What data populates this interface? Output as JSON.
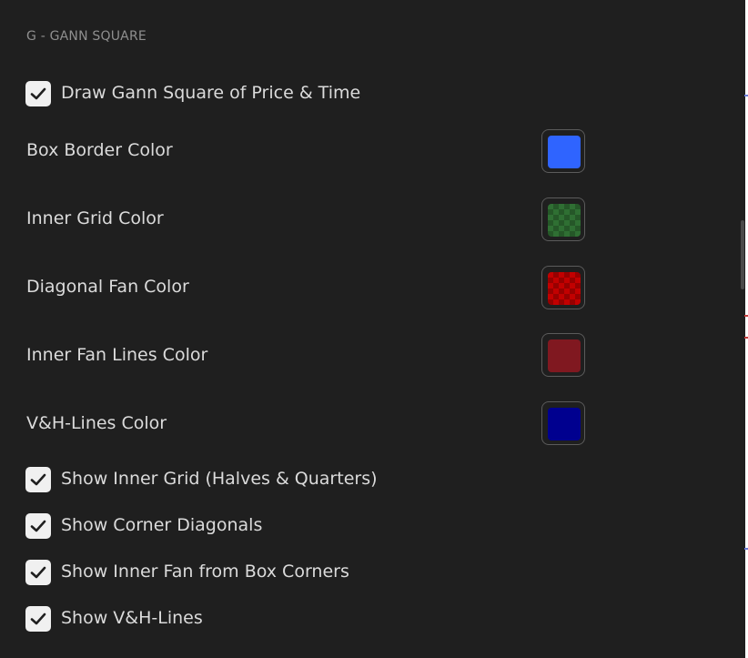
{
  "section": {
    "title": "G - GANN SQUARE"
  },
  "draw_gann_square": {
    "label": "Draw Gann Square of Price & Time",
    "checked": true
  },
  "color_settings": [
    {
      "label": "Box Border Color",
      "color": "#2f64ff",
      "pattern": "solid",
      "icon": "color-swatch-icon"
    },
    {
      "label": "Inner Grid Color",
      "color": "#2f6f33",
      "pattern": "checker",
      "icon": "color-swatch-icon"
    },
    {
      "label": "Diagonal Fan Color",
      "color": "#c20000",
      "pattern": "checker",
      "icon": "color-swatch-icon"
    },
    {
      "label": "Inner Fan Lines Color",
      "color": "#801820",
      "pattern": "solid",
      "icon": "color-swatch-icon"
    },
    {
      "label": "V&H-Lines Color",
      "color": "#00008f",
      "pattern": "solid",
      "icon": "color-swatch-icon"
    }
  ],
  "toggles": [
    {
      "label": "Show Inner Grid (Halves & Quarters)",
      "checked": true
    },
    {
      "label": "Show Corner Diagonals",
      "checked": true
    },
    {
      "label": "Show Inner Fan from Box Corners",
      "checked": true
    },
    {
      "label": "Show V&H-Lines",
      "checked": true
    }
  ],
  "icons": {
    "checkbox_mark": "check-icon"
  },
  "theme": {
    "panel_background": "#1f1f1f",
    "text": "#dbdbdb",
    "muted_text": "#8f8f8f",
    "checkbox_fill": "#f0f0f0",
    "checkmark": "#1f1f1f",
    "swatch_border": "#5b5b5b",
    "edge_marks": [
      "#c43b3b",
      "#6b7bd6"
    ]
  }
}
